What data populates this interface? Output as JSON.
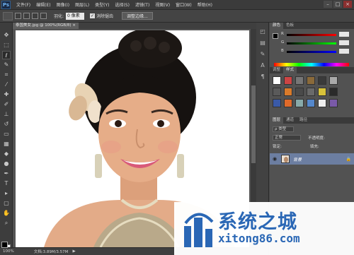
{
  "app": {
    "logo": "Ps"
  },
  "menubar": {
    "items": [
      "文件(F)",
      "编辑(E)",
      "图像(I)",
      "图层(L)",
      "类型(Y)",
      "选择(S)",
      "滤镜(T)",
      "视图(V)",
      "窗口(W)",
      "帮助(H)"
    ],
    "window_controls": [
      "–",
      "□",
      "×"
    ]
  },
  "optionsbar": {
    "feather_label": "羽化:",
    "feather_value": "0 像素",
    "antialias_label": "消除锯齿",
    "antialias_checked": true,
    "refine_button": "调整边缘..."
  },
  "document_tab": {
    "title": "泰国美女.jpg @ 100%(RGB/8) ×"
  },
  "statusbar": {
    "zoom": "100%",
    "doc_info": "文档:3.89M/3.57M",
    "arrow": "▶"
  },
  "panels": {
    "color_tabs": [
      "颜色",
      "色板"
    ],
    "color": {
      "channels": [
        {
          "label": "R",
          "value": "",
          "color": "#d33"
        },
        {
          "label": "G",
          "value": "",
          "color": "#3c3"
        },
        {
          "label": "B",
          "value": "",
          "color": "#36d"
        }
      ]
    },
    "style_tabs": [
      "调整",
      "样式"
    ],
    "layers_tabs": [
      "图层",
      "通道",
      "路径"
    ],
    "layers": {
      "kind_label": "ρ 类型",
      "blend_mode": "正常",
      "opacity_label": "不透明度:",
      "lock_label": "锁定:",
      "fill_label": "填充:",
      "items": [
        {
          "name": "背景",
          "visible": true,
          "locked": true
        }
      ]
    }
  },
  "watermark": {
    "brand": "系统之城",
    "url": "xitong86.com"
  }
}
